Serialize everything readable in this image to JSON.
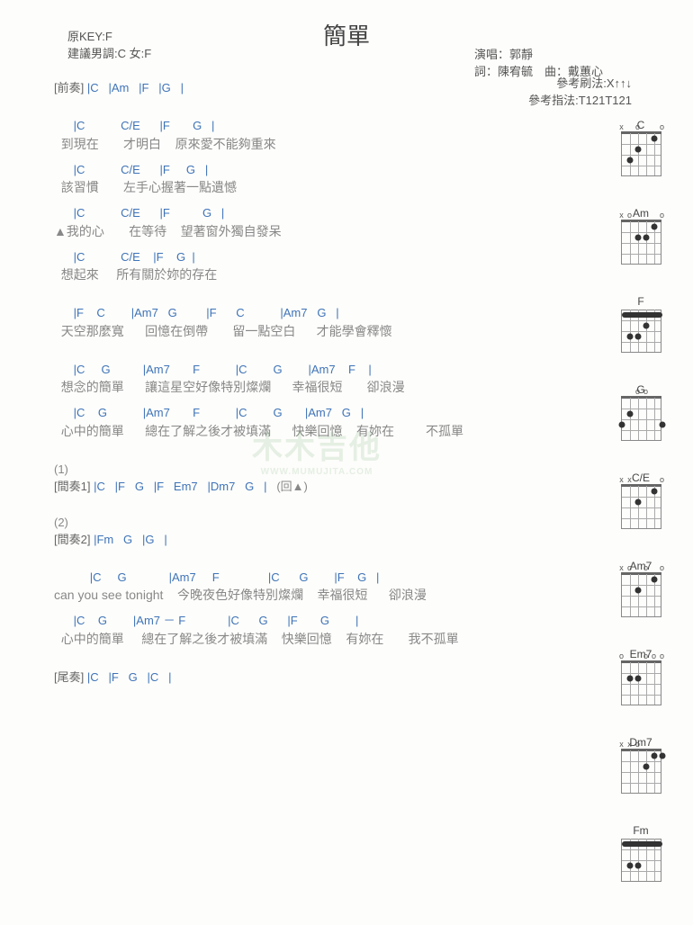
{
  "header": {
    "title": "簡單",
    "orig_key": "原KEY:F",
    "suggest": "建議男調:C 女:F",
    "singer": "演唱：郭靜",
    "credits": "詞：陳宥毓　曲：戴蕙心",
    "ref1": "參考刷法:X↑↑↓",
    "ref2": "參考指法:T121T121"
  },
  "intro": {
    "label": "[前奏] ",
    "chords": "|C   |Am   |F   |G   |"
  },
  "verses": [
    {
      "chords": "      |C           C/E      |F       G   |",
      "lyrics": "  到現在       才明白    原來愛不能夠重來"
    },
    {
      "chords": "      |C           C/E      |F     G   |",
      "lyrics": "  該習慣       左手心握著一點遺憾"
    },
    {
      "chords": "      |C           C/E      |F          G   |",
      "lyrics": "▲我的心       在等待    望著窗外獨自發呆"
    },
    {
      "chords": "      |C           C/E    |F    G  |",
      "lyrics": "  想起來     所有關於妳的存在"
    }
  ],
  "pre": [
    {
      "chords": "      |F    C        |Am7   G         |F      C           |Am7   G   |",
      "lyrics": "  天空那麼寬      回憶在倒帶       留一點空白      才能學會釋懷"
    }
  ],
  "chorus": [
    {
      "chords": "      |C     G          |Am7       F           |C        G        |Am7    F    |",
      "lyrics": "  想念的簡單      讓這星空好像特別燦爛      幸福很短       卻浪漫"
    },
    {
      "chords": "      |C    G           |Am7       F           |C        G       |Am7   G   |",
      "lyrics": "  心中的簡單      總在了解之後才被填滿      快樂回憶    有妳在         不孤單"
    }
  ],
  "inter": [
    {
      "label": "(1)",
      "section": "[間奏1] ",
      "chords": "|C   |F   G   |F   Em7   |Dm7   G   |",
      "tail": "   (回▲)"
    },
    {
      "label": "(2)",
      "section": "[間奏2] ",
      "chords": "|Fm   G   |G   |"
    }
  ],
  "bridge": [
    {
      "chords": "           |C     G             |Am7     F               |C      G        |F    G   |",
      "lyrics": "can you see tonight    今晚夜色好像特別燦爛    幸福很短      卻浪漫"
    },
    {
      "chords": "      |C    G        |Am7 － F             |C      G      |F       G        |",
      "lyrics": "  心中的簡單     總在了解之後才被填滿    快樂回憶    有妳在       我不孤單"
    }
  ],
  "outro": {
    "label": "[尾奏] ",
    "chords": "|C   |F   G   |C   |"
  },
  "chart_data": [
    {
      "name": "C",
      "barre": null,
      "open": [
        "x",
        "",
        "o",
        "",
        "",
        "o"
      ],
      "dots": [
        [
          2,
          1
        ],
        [
          4,
          2
        ],
        [
          5,
          3
        ]
      ]
    },
    {
      "name": "Am",
      "barre": null,
      "open": [
        "x",
        "o",
        "",
        "",
        "",
        "o"
      ],
      "dots": [
        [
          2,
          1
        ],
        [
          3,
          2
        ],
        [
          4,
          2
        ]
      ]
    },
    {
      "name": "F",
      "barre": {
        "fret": 1,
        "from": 1,
        "to": 6
      },
      "open": [],
      "dots": [
        [
          3,
          2
        ],
        [
          4,
          3
        ],
        [
          5,
          3
        ]
      ]
    },
    {
      "name": "G",
      "barre": null,
      "open": [
        "",
        "",
        "o",
        "o",
        "",
        ""
      ],
      "dots": [
        [
          5,
          2
        ],
        [
          6,
          3
        ],
        [
          1,
          3
        ]
      ]
    },
    {
      "name": "C/E",
      "barre": null,
      "open": [
        "x",
        "x",
        "",
        "",
        "",
        "o"
      ],
      "dots": [
        [
          2,
          1
        ],
        [
          4,
          2
        ]
      ]
    },
    {
      "name": "Am7",
      "barre": null,
      "open": [
        "x",
        "o",
        "",
        "o",
        "",
        "o"
      ],
      "dots": [
        [
          2,
          1
        ],
        [
          4,
          2
        ]
      ]
    },
    {
      "name": "Em7",
      "barre": null,
      "open": [
        "o",
        "",
        "",
        "o",
        "o",
        "o"
      ],
      "dots": [
        [
          5,
          2
        ],
        [
          4,
          2
        ]
      ]
    },
    {
      "name": "Dm7",
      "barre": null,
      "open": [
        "x",
        "x",
        "o",
        "",
        "",
        ""
      ],
      "dots": [
        [
          1,
          1
        ],
        [
          2,
          1
        ],
        [
          3,
          2
        ]
      ]
    },
    {
      "name": "Fm",
      "barre": {
        "fret": 1,
        "from": 1,
        "to": 6
      },
      "open": [],
      "dots": [
        [
          4,
          3
        ],
        [
          5,
          3
        ]
      ]
    }
  ],
  "watermark": {
    "big": "木木吉他",
    "small": "WWW.MUMUJITA.COM"
  }
}
